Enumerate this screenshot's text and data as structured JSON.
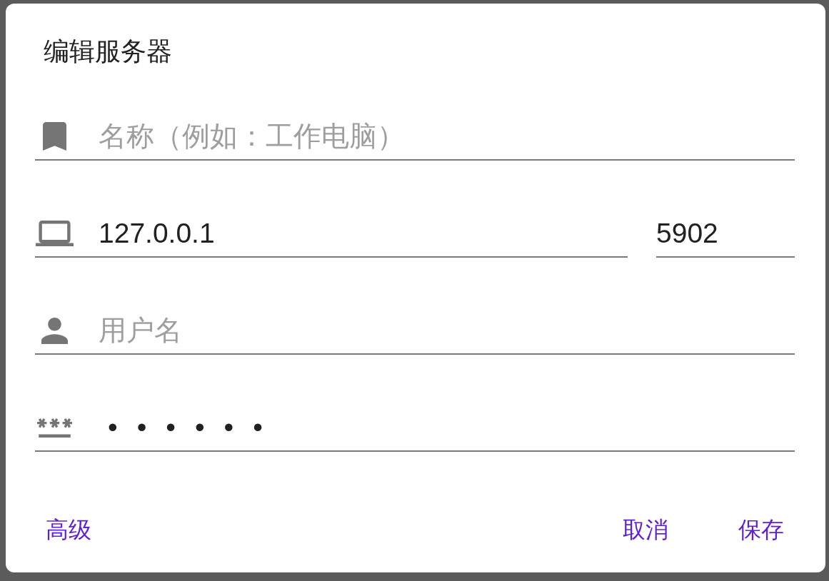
{
  "dialog": {
    "title": "编辑服务器"
  },
  "fields": [
    {
      "kind": "name",
      "placeholder": "名称（例如：工作电脑）"
    },
    {
      "kind": "host",
      "value": "127.0.0.1",
      "port": {
        "value": "5902"
      }
    },
    {
      "kind": "username",
      "placeholder": "用户名"
    },
    {
      "kind": "password",
      "value": "••••••"
    }
  ],
  "footer": {
    "left": [
      {
        "label": "高级"
      }
    ],
    "right": [
      {
        "label": "取消"
      },
      {
        "label": "保存"
      }
    ]
  }
}
